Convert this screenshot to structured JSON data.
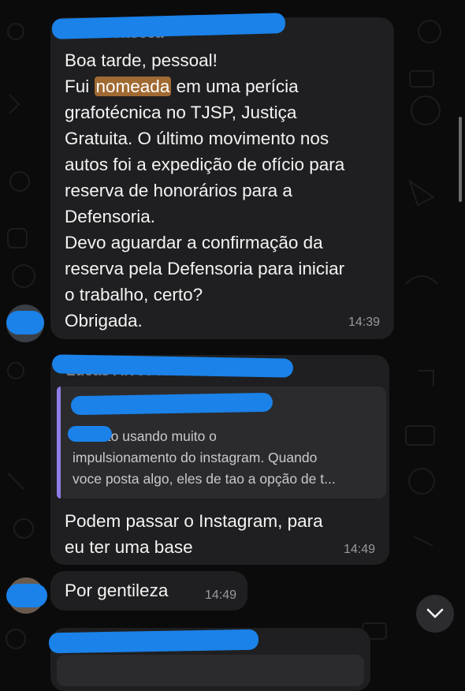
{
  "messages": [
    {
      "lines_before": "Boa tarde, pessoal!\nFui ",
      "highlight": "nomeada",
      "lines_after": " em uma perícia\ngrafotécnica no TJSP, Justiça\nGratuita. O último movimento nos\nautos foi a expedição de ofício para\nreserva de honorários para a\nDefensoria.\nDevo aguardar a confirmação da\nreserva pela Defensoria para iniciar\no trabalho, certo?\nObrigada.",
      "time": "14:39"
    },
    {
      "quote_text": "...    eu to usando muito o\nimpulsionamento do instagram. Quando\nvoce posta algo, eles de tao a opção de t...",
      "text": "Podem passar o Instagram,  para\neu ter uma base",
      "time": "14:49"
    },
    {
      "text": "Por gentileza",
      "time": "14:49"
    }
  ],
  "colors": {
    "bubble": "#1f1f21",
    "highlight": "#a06a32",
    "quote_bar": "#8e7ee6",
    "redaction": "#1a82e8"
  },
  "icons": {
    "scroll_down": "chevron-down-icon"
  }
}
